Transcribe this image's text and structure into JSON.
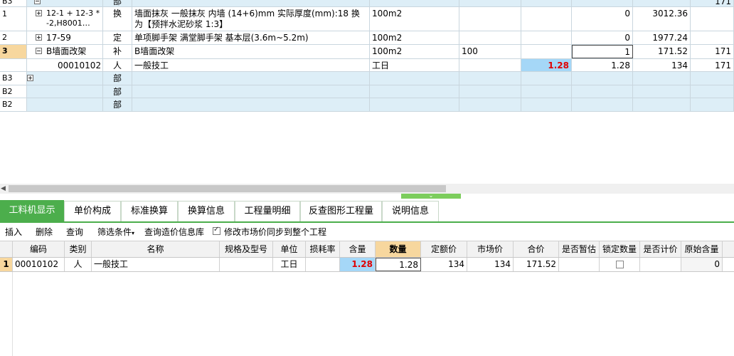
{
  "upper_grid": {
    "rows": [
      {
        "num": "B3",
        "code": "",
        "type": "部",
        "name": "",
        "unit": "",
        "qty_expr": "",
        "content": "",
        "qty": "",
        "unit_price": "",
        "total": "171",
        "expander": "minus"
      },
      {
        "num": "1",
        "code": "12-1 + 12-3 * -2,H8001…",
        "type": "换",
        "name": "墙面抹灰 一般抹灰 内墙 (14+6)mm  实际厚度(mm):18  换为【预拌水泥砂浆 1:3】",
        "unit": "100m2",
        "qty_expr": "",
        "content": "",
        "qty": "0",
        "unit_price": "3012.36",
        "total": "",
        "expander": "plus"
      },
      {
        "num": "2",
        "code": "17-59",
        "type": "定",
        "name": "单项脚手架 满堂脚手架 基本层(3.6m~5.2m)",
        "unit": "100m2",
        "qty_expr": "",
        "content": "",
        "qty": "0",
        "unit_price": "1977.24",
        "total": "",
        "expander": "plus"
      },
      {
        "num": "3",
        "code": "B墙面改架",
        "type": "补",
        "name": "B墙面改架",
        "unit": "100m2",
        "qty_expr": "100",
        "content": "",
        "qty": "1",
        "unit_price": "171.52",
        "total": "171",
        "expander": "minus"
      },
      {
        "num": "",
        "code": "00010102",
        "type": "人",
        "name": "一般技工",
        "unit": "工日",
        "qty_expr": "",
        "content": "1.28",
        "qty": "1.28",
        "unit_price": "134",
        "total": "171",
        "expander": ""
      },
      {
        "num": "B3",
        "code": "",
        "type": "部",
        "name": "",
        "unit": "",
        "qty_expr": "",
        "content": "",
        "qty": "",
        "unit_price": "",
        "total": "",
        "expander": "plus"
      },
      {
        "num": "B2",
        "code": "",
        "type": "部",
        "name": "",
        "unit": "",
        "qty_expr": "",
        "content": "",
        "qty": "",
        "unit_price": "",
        "total": "",
        "expander": "plus"
      },
      {
        "num": "B2",
        "code": "",
        "type": "部",
        "name": "",
        "unit": "",
        "qty_expr": "",
        "content": "",
        "qty": "",
        "unit_price": "",
        "total": "",
        "expander": "plus"
      }
    ]
  },
  "tabs": [
    "工料机显示",
    "单价构成",
    "标准换算",
    "换算信息",
    "工程量明细",
    "反查图形工程量",
    "说明信息"
  ],
  "toolbar": {
    "insert": "插入",
    "delete": "删除",
    "query": "查询",
    "filter": "筛选条件",
    "query_price_lib": "查询造价信息库",
    "sync_market_price": "修改市场价同步到整个工程"
  },
  "lower_grid": {
    "headers": [
      "编码",
      "类别",
      "名称",
      "规格及型号",
      "单位",
      "损耗率",
      "含量",
      "数量",
      "定额价",
      "市场价",
      "合价",
      "是否暂估",
      "锁定数量",
      "是否计价",
      "原始含量"
    ],
    "row": {
      "index": "1",
      "code": "00010102",
      "type": "人",
      "name": "一般技工",
      "spec": "",
      "unit": "工日",
      "loss_rate": "",
      "content": "1.28",
      "qty": "1.28",
      "quota_price": "134",
      "market_price": "134",
      "total": "171.52",
      "is_estimate": "",
      "is_priced": "",
      "original_content": "0"
    }
  },
  "colors": {
    "accent_green": "#4cae4c",
    "selection_blue": "#a5d7f7",
    "highlight_header": "#f7d79e",
    "value_red": "#e00000"
  }
}
